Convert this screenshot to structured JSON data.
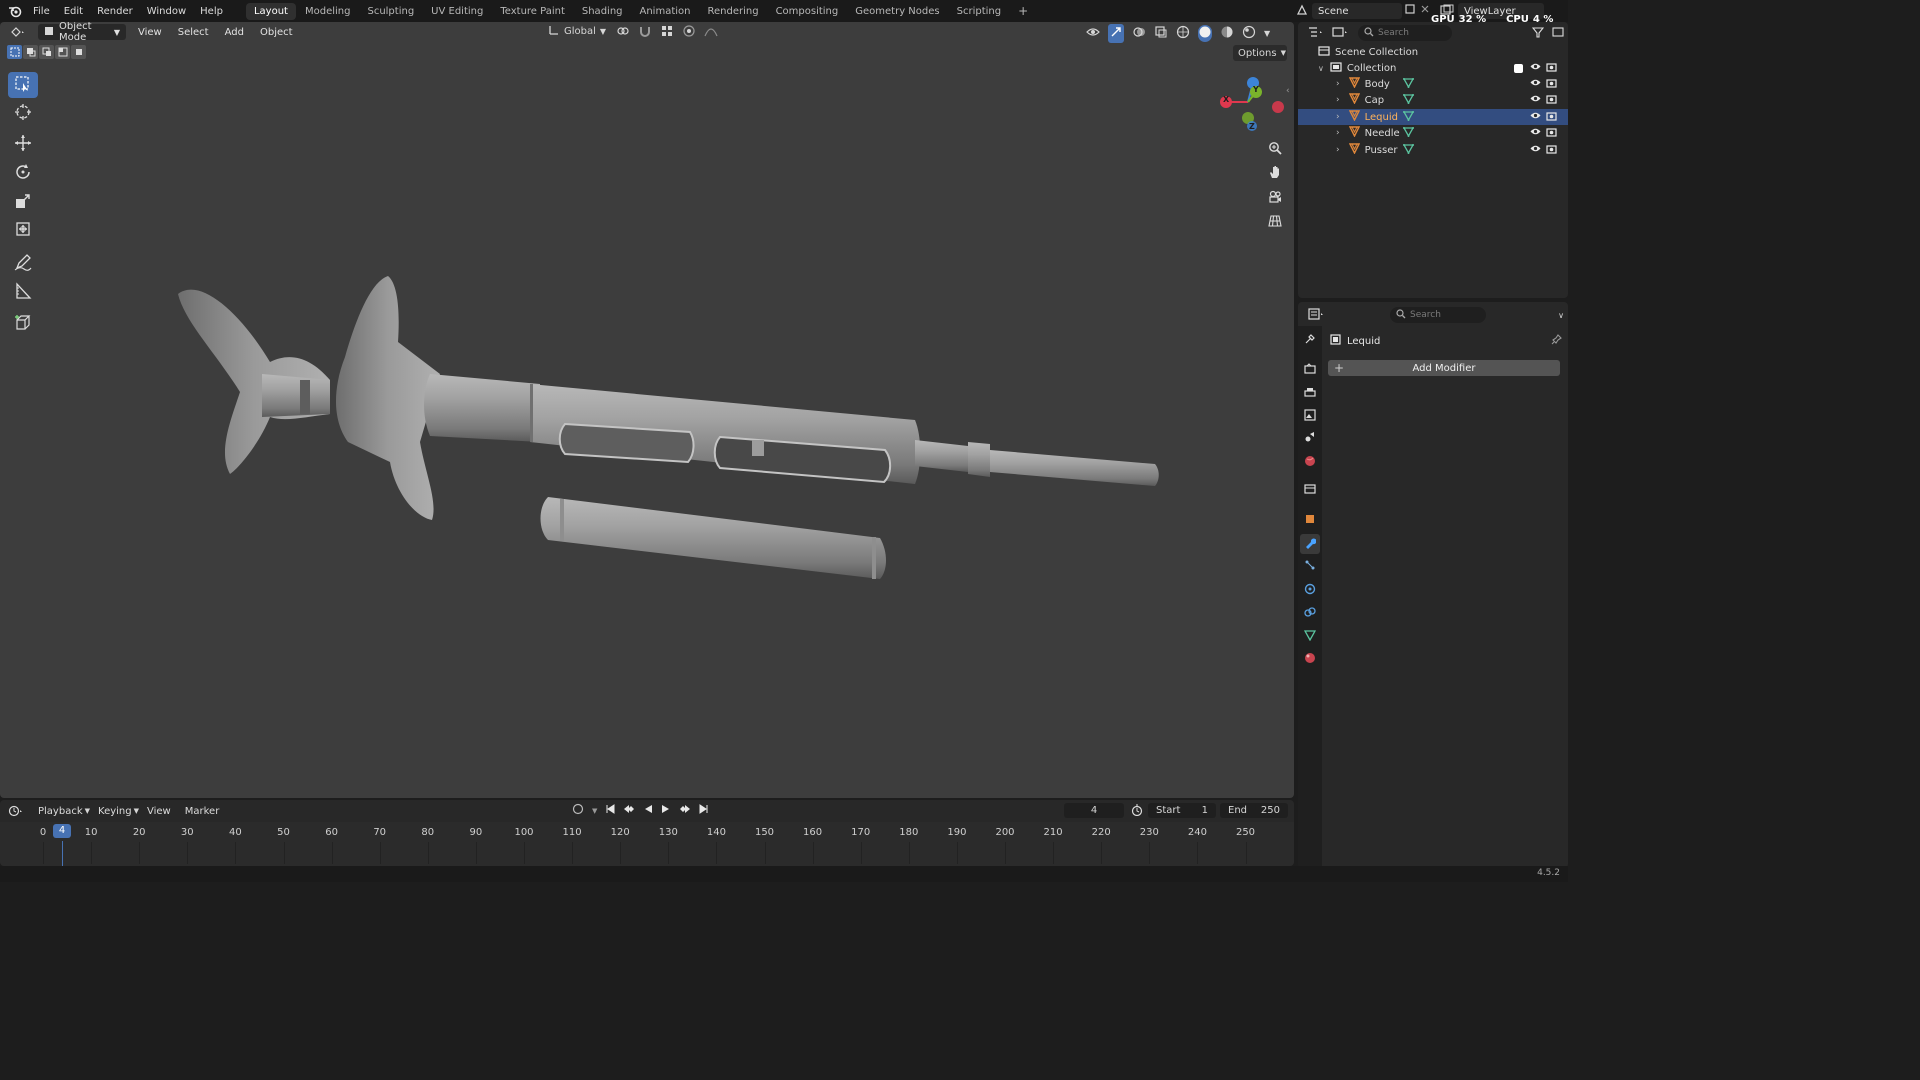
{
  "topbar": {
    "menus": [
      "File",
      "Edit",
      "Render",
      "Window",
      "Help"
    ],
    "workspaces": [
      "Layout",
      "Modeling",
      "Sculpting",
      "UV Editing",
      "Texture Paint",
      "Shading",
      "Animation",
      "Rendering",
      "Compositing",
      "Geometry Nodes",
      "Scripting"
    ],
    "active_workspace": "Layout",
    "add_tab_label": "+",
    "scene_name": "Scene",
    "view_layer": "ViewLayer",
    "gpu_label": "GPU",
    "gpu_value": "32 %",
    "cpu_label": "CPU",
    "cpu_value": "4 %"
  },
  "viewport": {
    "mode": "Object Mode",
    "menus": [
      "View",
      "Select",
      "Add",
      "Object"
    ],
    "orientation": "Global",
    "options_label": "Options",
    "gizmo_axes": {
      "x": "X",
      "y": "Y",
      "z": "Z"
    },
    "axis_colors": {
      "x": "#e0384e",
      "y": "#7ab32b",
      "z": "#3c84d8"
    },
    "tools": [
      "select-box",
      "cursor",
      "move",
      "rotate",
      "scale",
      "transform",
      "annotate",
      "measure",
      "add-cube"
    ],
    "active_tool": "select-box"
  },
  "outliner": {
    "search_placeholder": "Search",
    "scene_collection": "Scene Collection",
    "collection": "Collection",
    "objects": [
      {
        "name": "Body",
        "selected": false
      },
      {
        "name": "Cap",
        "selected": false
      },
      {
        "name": "Lequid",
        "selected": true
      },
      {
        "name": "Needle",
        "selected": false
      },
      {
        "name": "Pusser",
        "selected": false
      }
    ]
  },
  "properties": {
    "search_placeholder": "Search",
    "object_name": "Lequid",
    "add_modifier_label": "Add Modifier",
    "active_tab": "modifier"
  },
  "timeline": {
    "menus": [
      "Playback",
      "Keying",
      "View",
      "Marker"
    ],
    "current_frame": "4",
    "start_label": "Start",
    "start_value": "1",
    "end_label": "End",
    "end_value": "250",
    "ticks": [
      "0",
      "10",
      "20",
      "30",
      "40",
      "50",
      "60",
      "70",
      "80",
      "90",
      "100",
      "110",
      "120",
      "130",
      "140",
      "150",
      "160",
      "170",
      "180",
      "190",
      "200",
      "210",
      "220",
      "230",
      "240",
      "250"
    ]
  },
  "status": {
    "version": "4.5.2"
  },
  "colors": {
    "accent": "#4772b3",
    "selection": "#334d80",
    "active_object_text": "#ffb35a",
    "mesh_icon": "#e0873b",
    "mesh_data_icon": "#5bc5a0"
  }
}
